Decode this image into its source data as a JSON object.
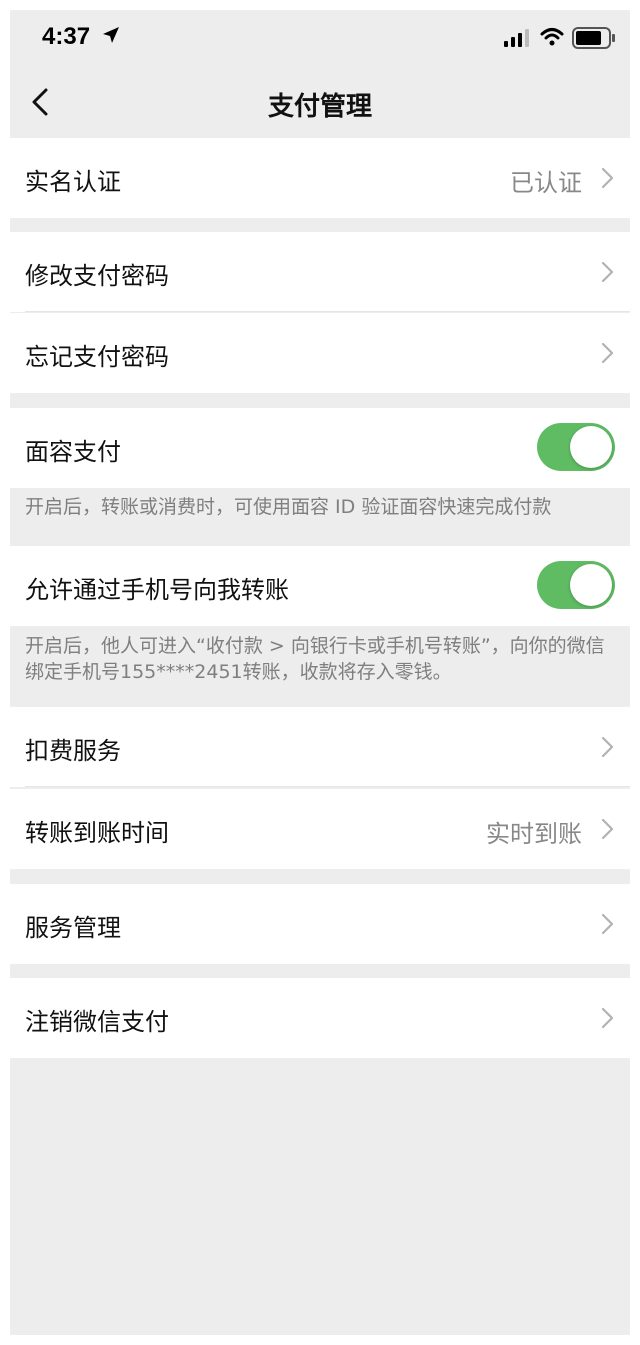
{
  "status_bar": {
    "time": "4:37",
    "icons": [
      "location-arrow-icon",
      "signal-icon",
      "wifi-icon",
      "battery-icon"
    ]
  },
  "nav": {
    "back_icon": "chevron-left-icon",
    "title": "支付管理"
  },
  "items": {
    "real_name": {
      "label": "实名认证",
      "value": "已认证"
    },
    "change_password": {
      "label": "修改支付密码"
    },
    "forgot_password": {
      "label": "忘记支付密码"
    },
    "face_pay": {
      "label": "面容支付",
      "enabled": true,
      "note": "开启后，转账或消费时，可使用面容 ID 验证面容快速完成付款"
    },
    "phone_transfer": {
      "label": "允许通过手机号向我转账",
      "enabled": true,
      "note": "开启后，他人可进入“收付款 > 向银行卡或手机号转账”，向你的微信绑定手机号155****2451转账，收款将存入零钱。"
    },
    "deduction_service": {
      "label": "扣费服务"
    },
    "transfer_time": {
      "label": "转账到账时间",
      "value": "实时到账"
    },
    "service_manage": {
      "label": "服务管理"
    },
    "cancel_wechat_pay": {
      "label": "注销微信支付"
    }
  },
  "colors": {
    "background": "#ededed",
    "cell": "#ffffff",
    "toggle_on": "#5fbc63",
    "secondary_text": "#888888"
  }
}
